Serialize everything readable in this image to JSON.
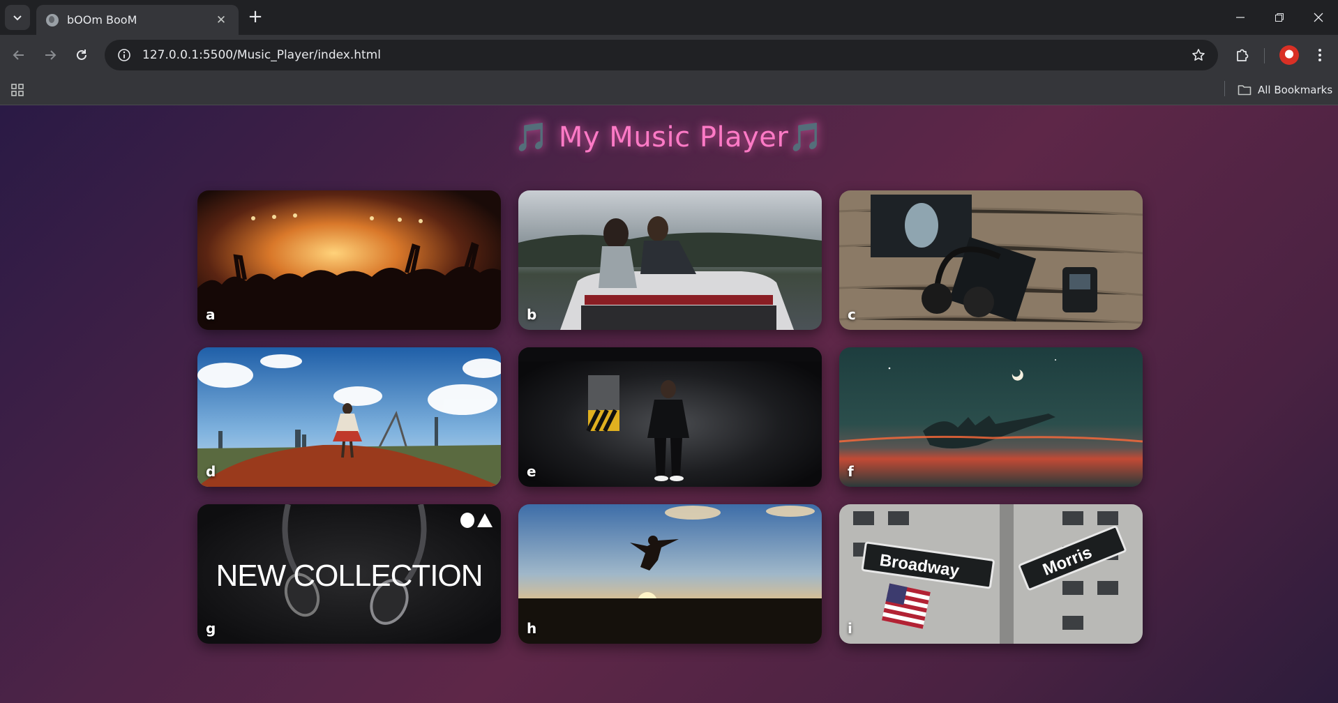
{
  "browser": {
    "tab": {
      "title": "bOOm BooM"
    },
    "address_bar": {
      "url": "127.0.0.1:5500/Music_Player/index.html"
    },
    "bookmarks_bar": {
      "all_bookmarks_label": "All Bookmarks"
    }
  },
  "page": {
    "title": "🎵 My Music Player🎵",
    "cards": [
      {
        "label": "a",
        "scene": "concert-crowd"
      },
      {
        "label": "b",
        "scene": "friends-on-car-roof"
      },
      {
        "label": "c",
        "scene": "headphones-album-on-wood"
      },
      {
        "label": "d",
        "scene": "girl-on-dirt-hill"
      },
      {
        "label": "e",
        "scene": "man-in-parking-garage"
      },
      {
        "label": "f",
        "scene": "hand-silhouette-night-sky"
      },
      {
        "label": "g",
        "scene": "headphones-collection-ad",
        "overlay_text": "NEW COLLECTION"
      },
      {
        "label": "h",
        "scene": "person-jumping-sunset"
      },
      {
        "label": "i",
        "scene": "broadway-morris-street-sign"
      }
    ]
  },
  "colors": {
    "title_pink": "#ff7ac6",
    "chrome_dark": "#202124",
    "chrome_toolbar": "#35363a"
  }
}
